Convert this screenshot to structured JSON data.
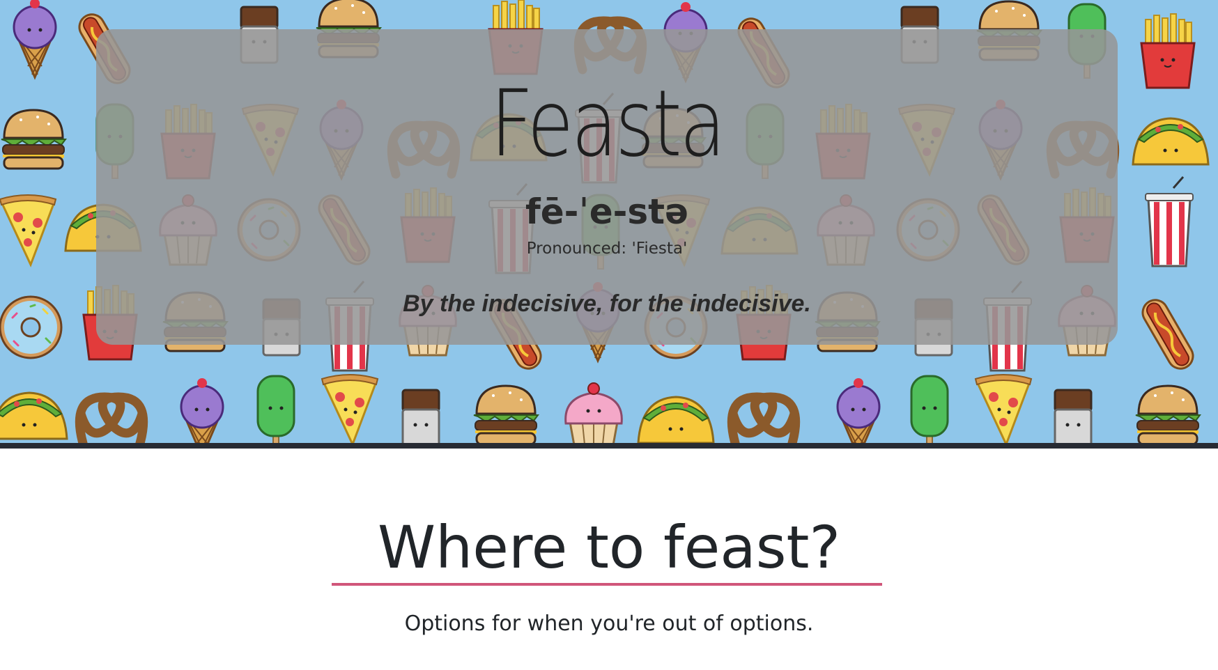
{
  "hero": {
    "background_color": "#8fc6ea",
    "pattern_icons": [
      "ice-cream-cone-icon",
      "burger-icon",
      "fries-icon",
      "pretzel-icon",
      "pizza-slice-icon",
      "taco-icon",
      "donut-icon",
      "cupcake-icon",
      "soda-cup-icon",
      "hot-dog-icon",
      "popsicle-icon",
      "ice-cream-sandwich-icon"
    ],
    "panel": {
      "brand": "Feasta",
      "phonetic": "fē-ˈe-stə",
      "pronounced": "Pronounced: 'Fiesta'",
      "tagline": "By the indecisive, for the indecisive."
    }
  },
  "section": {
    "title": "Where to feast?",
    "subtitle": "Options for when you're out of options.",
    "rule_color": "#d0567a"
  }
}
